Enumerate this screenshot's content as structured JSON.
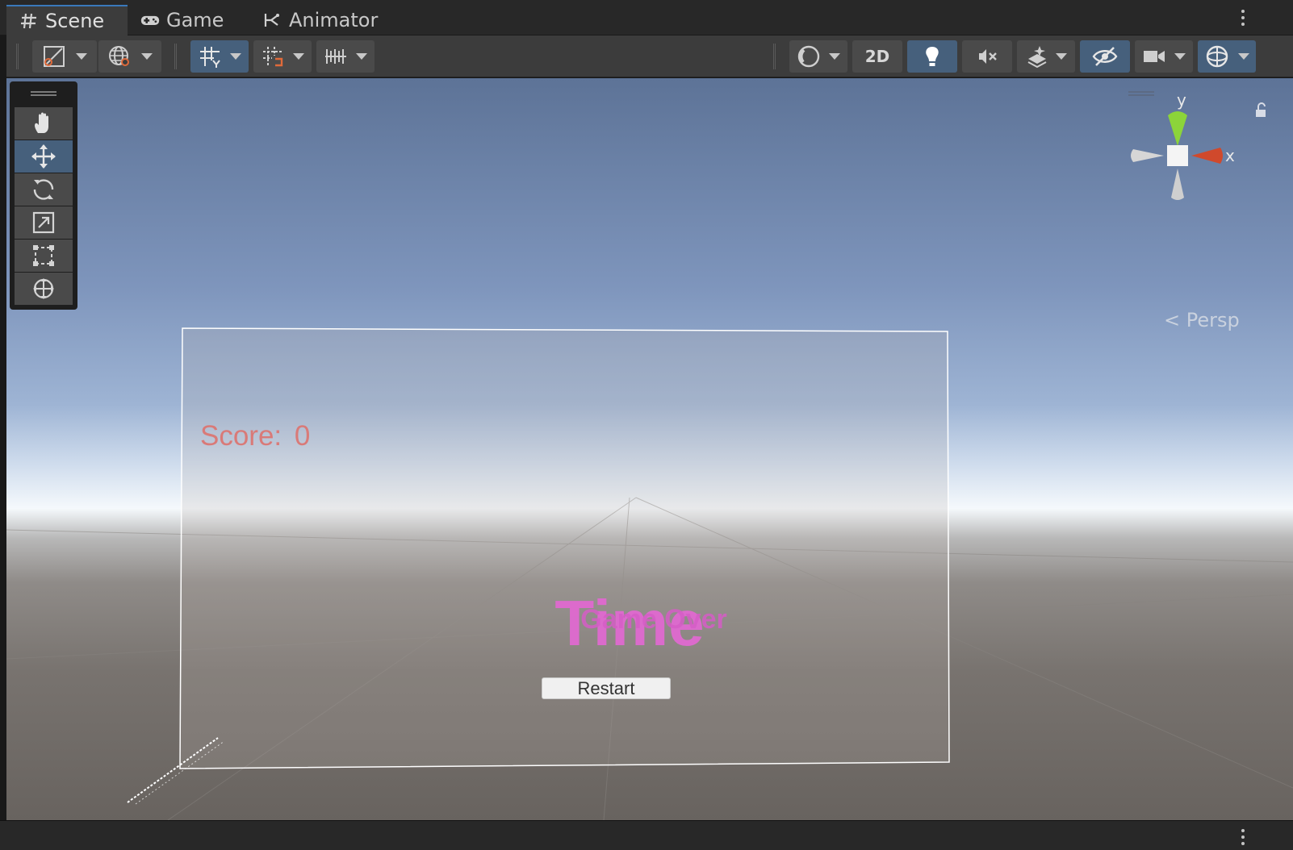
{
  "tabs": [
    {
      "label": "Scene",
      "icon": "grid-hash-icon",
      "active": true
    },
    {
      "label": "Game",
      "icon": "gamepad-icon",
      "active": false
    },
    {
      "label": "Animator",
      "icon": "animator-icon",
      "active": false
    }
  ],
  "toolbar": {
    "left": [
      "draw-mode-icon",
      "global-local-icon",
      "grid-snap-icon",
      "increment-snap-icon",
      "ruler-snap-icon"
    ],
    "right": {
      "shading_icon": "sphere-shading-icon",
      "mode_2d_label": "2D",
      "lighting_icon": "lightbulb-icon",
      "audio_icon": "audio-mute-icon",
      "effects_icon": "effects-icon",
      "hidden_icon": "eye-hidden-icon",
      "camera_icon": "camera-icon",
      "gizmos_icon": "gizmo-globe-icon"
    }
  },
  "tools": [
    "hand-tool-icon",
    "move-tool-icon",
    "rotate-tool-icon",
    "scale-tool-icon",
    "rect-tool-icon",
    "transform-tool-icon"
  ],
  "active_tool": "move-tool-icon",
  "scene": {
    "score_label": "Score:",
    "score_value": "0",
    "time_text": "Time",
    "game_over_text": "Game Over",
    "restart_label": "Restart"
  },
  "gizmo": {
    "y_label": "y",
    "x_label": "x",
    "projection_label": "Persp",
    "colors": {
      "y": "#8cd43a",
      "x": "#d0492c",
      "neutral": "#d6d6d6"
    }
  },
  "colors": {
    "accent": "#3a79bb",
    "active_button": "#46607c",
    "score_text": "#d97a78",
    "time_text": "#e06ad0"
  }
}
